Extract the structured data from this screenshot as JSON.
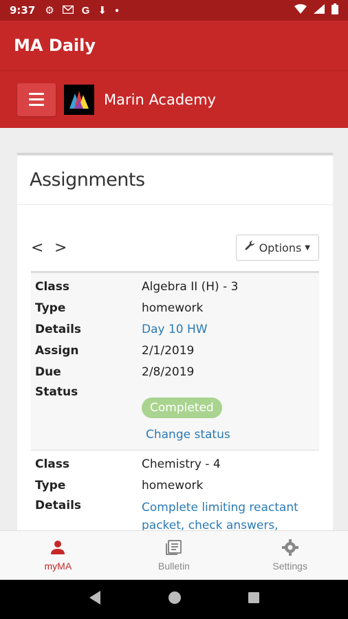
{
  "status_bar": {
    "time": "9:37",
    "icons": [
      "gear-icon",
      "gmail-icon",
      "google-icon",
      "download-icon",
      "dot-icon"
    ],
    "right_icons": [
      "wifi-icon",
      "signal-icon",
      "battery-icon"
    ]
  },
  "app_bar": {
    "title": "MA Daily"
  },
  "school_bar": {
    "name": "Marin Academy"
  },
  "card": {
    "title": "Assignments",
    "prev": "<",
    "next": ">",
    "options_label": "Options"
  },
  "assignments": [
    {
      "class_label": "Class",
      "class": "Algebra II (H) - 3",
      "type_label": "Type",
      "type": "homework",
      "details_label": "Details",
      "details": "Day 10 HW",
      "assign_label": "Assign",
      "assign": "2/1/2019",
      "due_label": "Due",
      "due": "2/8/2019",
      "status_label": "Status",
      "status": "Completed",
      "change_status": "Change status"
    },
    {
      "class_label": "Class",
      "class": "Chemistry - 4",
      "type_label": "Type",
      "type": "homework",
      "details_label": "Details",
      "details_line1": "Complete limiting reactant",
      "details_line2": "packet, check answers,"
    }
  ],
  "bottom_nav": [
    {
      "label": "myMA",
      "icon": "person-icon",
      "active": true
    },
    {
      "label": "Bulletin",
      "icon": "bulletin-icon",
      "active": false
    },
    {
      "label": "Settings",
      "icon": "gear-icon",
      "active": false
    }
  ],
  "colors": {
    "primary": "#c62828",
    "statusbar": "#a31c1c",
    "link": "#2a7ab5",
    "badge": "#a9d48f"
  }
}
